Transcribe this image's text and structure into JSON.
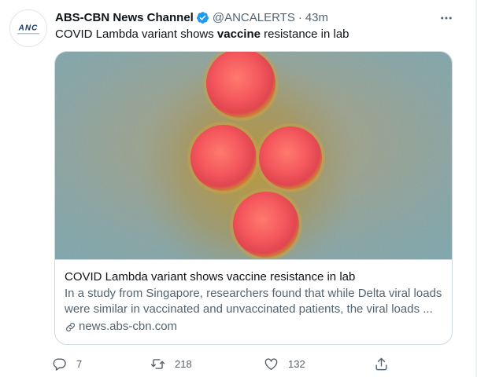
{
  "tweet": {
    "author": {
      "name": "ABS-CBN News Channel",
      "handle": "@ANCALERTS",
      "avatar_text": "ANC",
      "verified": true,
      "avatar_icon": "anc-logo-icon"
    },
    "separator": "·",
    "time": "43m",
    "text": {
      "before": "COVID Lambda variant shows ",
      "bold": "vaccine",
      "after": " resistance in lab"
    },
    "card": {
      "image_icon": "virus-micrograph-image",
      "title": "COVID Lambda variant shows vaccine resistance in lab",
      "description_line1": "In a study from Singapore, researchers found that while Delta viral loads",
      "description_line2": "were similar in vaccinated and unvaccinated patients, the viral loads ...",
      "domain": "news.abs-cbn.com",
      "domain_icon": "link-icon"
    },
    "actions": {
      "reply": {
        "icon": "reply-icon",
        "count": "7"
      },
      "retweet": {
        "icon": "retweet-icon",
        "count": "218"
      },
      "like": {
        "icon": "heart-icon",
        "count": "132"
      },
      "share": {
        "icon": "share-icon"
      }
    },
    "more_icon": "more-options-icon"
  },
  "colors": {
    "text_primary": "#0f1419",
    "text_secondary": "#536471",
    "verified_blue": "#1d9bf0",
    "border": "#cfd9de",
    "virus_red": "#f0505a"
  }
}
